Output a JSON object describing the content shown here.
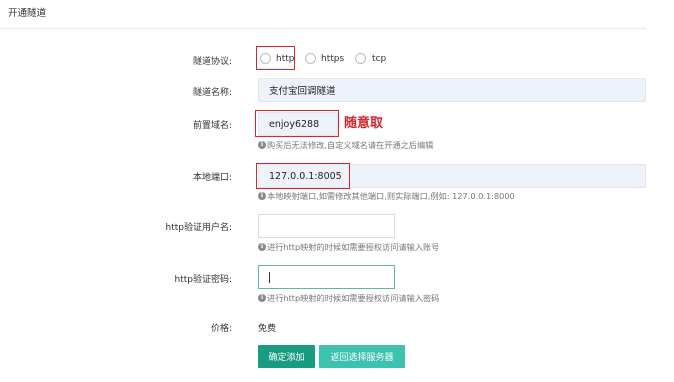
{
  "page": {
    "title": "开通隧道"
  },
  "protocol": {
    "label": "隧道协议:",
    "options": [
      "http",
      "https",
      "tcp"
    ]
  },
  "name_field": {
    "label": "隧道名称:",
    "value": "支付宝回调隧道"
  },
  "domain_field": {
    "label": "前置域名:",
    "value": "enjoy6288",
    "annotation": "随意取",
    "hint": "购买后无法修改,自定义域名请在开通之后编辑"
  },
  "port_field": {
    "label": "本地端口:",
    "value": "127.0.0.1:8005",
    "hint": "本地映射端口,如需修改其他端口,则实际端口,例如: 127.0.0.1:8000"
  },
  "http_user_field": {
    "label": "http验证用户名:",
    "value": "",
    "hint": "进行http映射的时候如需要授权访问请输入账号"
  },
  "http_pass_field": {
    "label": "http验证密码:",
    "value": "",
    "hint": "进行http映射的时候如需要授权访问请输入密码"
  },
  "price": {
    "label": "价格:",
    "value": "免费"
  },
  "buttons": {
    "confirm": "确定添加",
    "back": "返回选择服务器"
  },
  "colors": {
    "highlight": "#d9262d",
    "primary": "#179c82",
    "secondary": "#3bc3b0",
    "input_bg": "#eef3fb"
  },
  "icons": {
    "info": "info-circle-icon"
  }
}
